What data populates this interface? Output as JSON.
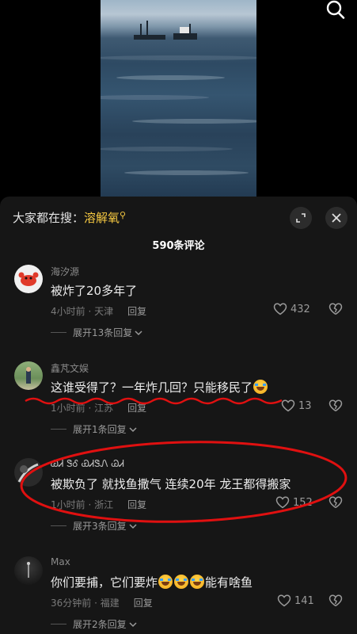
{
  "header": {
    "hot_search_prefix": "大家都在搜：",
    "hot_search_keyword": "溶解氧"
  },
  "comment_count": "590条评论",
  "comments": [
    {
      "username": "海汐源",
      "text": "被炸了20多年了",
      "time_location": "4小时前 · 天津",
      "reply_label": "回复",
      "likes": "432",
      "more_replies": "展开13条回复"
    },
    {
      "username": "鑫芃文娱",
      "text": "这谁受得了？一年炸几回？只能移民了",
      "time_location": "1小时前 · 江苏",
      "reply_label": "回复",
      "likes": "13",
      "more_replies": "展开1条回复"
    },
    {
      "username": "ᏊᏗ ᏕᎴ ᏯᏗᏕᏁ ᏊᏗ",
      "text": "被欺负了 就找鱼撒气 连续20年 龙王都得搬家",
      "time_location": "1小时前 · 浙江",
      "reply_label": "回复",
      "likes": "152",
      "more_replies": "展开3条回复"
    },
    {
      "username": "Max",
      "text": "你们要捕，它们要炸",
      "text_suffix": "能有啥鱼",
      "time_location": "36分钟前 · 福建",
      "reply_label": "回复",
      "likes": "141",
      "more_replies": "展开2条回复"
    }
  ],
  "colors": {
    "highlight_keyword": "#f5c842",
    "annotation_red": "#e01010",
    "sheet_background": "#161616"
  },
  "icons": [
    "search-icon",
    "expand-icon",
    "close-icon",
    "heart-icon",
    "broken-heart-icon",
    "chevron-down-icon",
    "crying-laughing-emoji"
  ]
}
